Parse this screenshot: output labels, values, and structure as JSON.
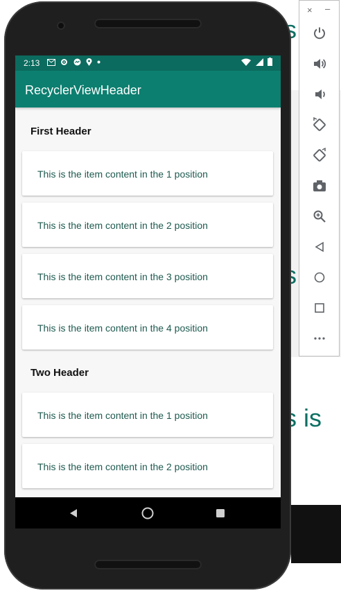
{
  "background": {
    "text_top": "s",
    "text_mid": "s",
    "text_bottom": "s is"
  },
  "status_bar": {
    "time": "2:13",
    "left_icons": [
      "gmail-icon",
      "settings-icon",
      "messenger-icon",
      "location-icon",
      "dot-icon"
    ],
    "right_icons": [
      "wifi-icon",
      "signal-icon",
      "battery-icon"
    ]
  },
  "app_bar": {
    "title": "RecyclerViewHeader"
  },
  "list": {
    "sections": [
      {
        "header": "First Header",
        "items": [
          "This is the item content in the 1 position",
          "This is the item content in the 2 position",
          "This is the item content in the 3 position",
          "This is the item content in the 4 position"
        ]
      },
      {
        "header": "Two Header",
        "items": [
          "This is the item content in the 1 position",
          "This is the item content in the 2 position"
        ]
      }
    ]
  },
  "nav_bar": {
    "buttons": [
      "back-icon",
      "home-icon",
      "recents-icon"
    ]
  },
  "emulator_toolbar": {
    "close": "×",
    "minimize": "–",
    "buttons": [
      "power-icon",
      "volume-up-icon",
      "volume-down-icon",
      "rotate-left-icon",
      "rotate-right-icon",
      "camera-icon",
      "zoom-icon",
      "back-icon",
      "home-icon",
      "overview-icon",
      "more-icon"
    ]
  },
  "colors": {
    "status_bar": "#0b6b5e",
    "app_bar": "#0c7f70",
    "item_text": "#1e5a4f"
  }
}
